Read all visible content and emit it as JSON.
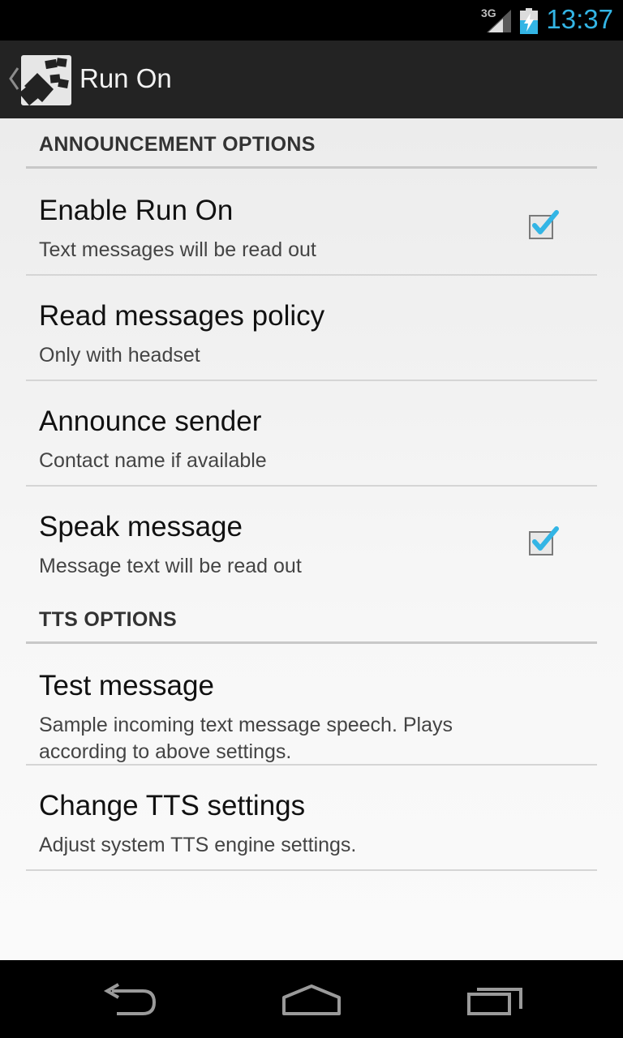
{
  "status_bar": {
    "network": "3G",
    "time": "13:37",
    "icons": [
      "signal-icon",
      "battery-charging-icon"
    ],
    "accent_color": "#33b5e5"
  },
  "action_bar": {
    "title": "Run On",
    "icons": [
      "up-caret-icon",
      "app-icon"
    ]
  },
  "sections": [
    {
      "header": "ANNOUNCEMENT OPTIONS",
      "items": [
        {
          "title": "Enable Run On",
          "summary": "Text messages will be read out",
          "checked": true
        },
        {
          "title": "Read messages policy",
          "summary": "Only with headset"
        },
        {
          "title": "Announce sender",
          "summary": "Contact name if available"
        },
        {
          "title": "Speak message",
          "summary": "Message text will be read out",
          "checked": true
        }
      ]
    },
    {
      "header": "TTS OPTIONS",
      "items": [
        {
          "title": "Test message",
          "summary": "Sample incoming text message speech. Plays according to above settings."
        },
        {
          "title": "Change TTS settings",
          "summary": "Adjust system TTS engine settings."
        }
      ]
    }
  ],
  "nav_bar": {
    "icons": [
      "back-icon",
      "home-icon",
      "recent-apps-icon"
    ]
  },
  "colors": {
    "checkmark": "#33b5e5",
    "background": "#f4f4f4",
    "action_bar": "#232323"
  }
}
